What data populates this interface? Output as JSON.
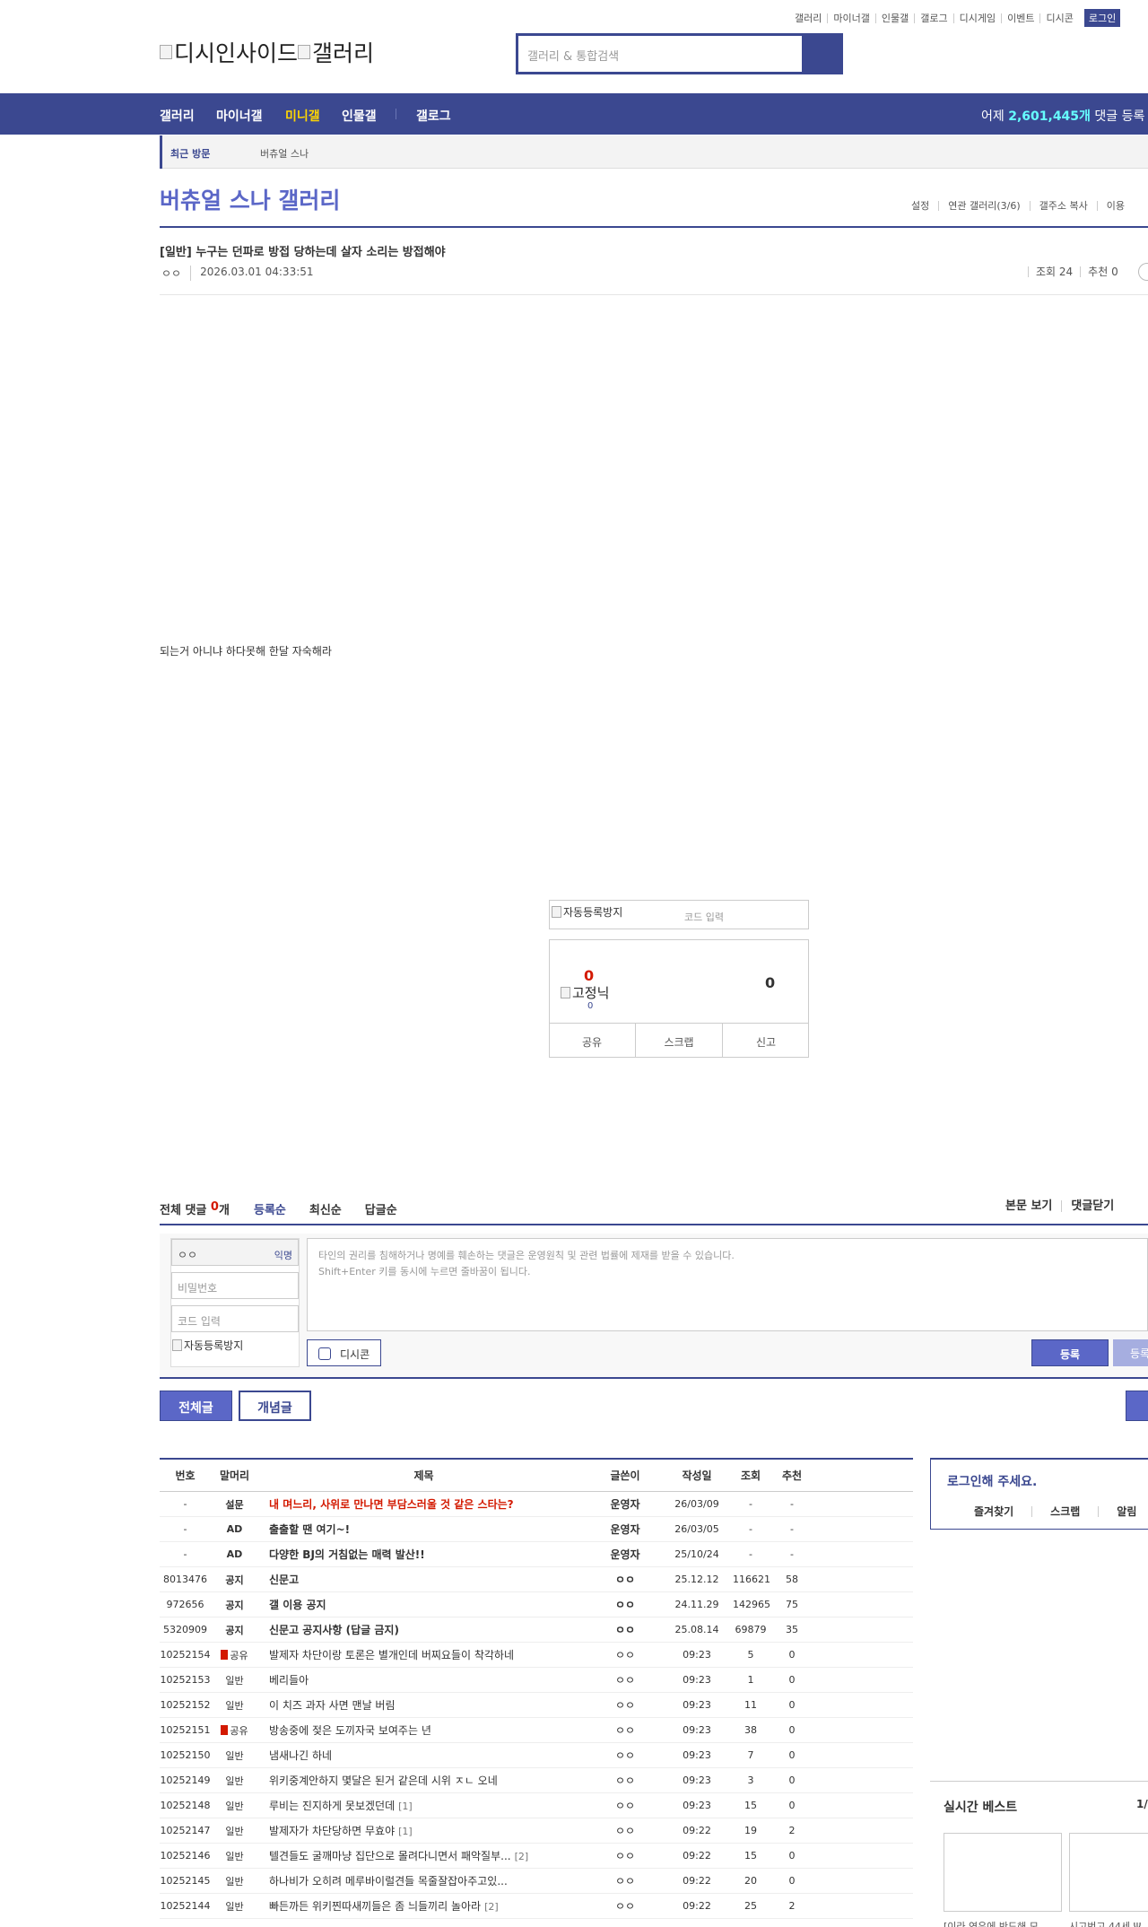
{
  "util_links": [
    "갤러리",
    "마이너갤",
    "인물갤",
    "갤로그",
    "디시게임",
    "이벤트",
    "디시콘"
  ],
  "login_label": "로그인",
  "logo": {
    "main_alt": "디시인사이드",
    "sub_alt": "갤러리"
  },
  "search": {
    "placeholder": "갤러리 & 통합검색"
  },
  "gnb": {
    "items": [
      "갤러리",
      "마이너갤",
      "미니갤",
      "인물갤",
      "갤로그"
    ],
    "active_color": "#ffd600",
    "stat_prefix": "어제",
    "stat_count": "2,601,445개",
    "stat_suffix": "댓글 등록"
  },
  "subnav": {
    "active": "최근 방문",
    "visited": "버츄얼 스나"
  },
  "gallery": {
    "title": "버츄얼 스나 갤러리",
    "menu": [
      "설정",
      "연관 갤러리(3/6)",
      "갤주소 복사",
      "이용"
    ]
  },
  "post": {
    "title": "[일반] 누구는 던파로 방접 당하는데 살자 소리는 방접해야",
    "writer": "ㅇㅇ",
    "date": "2026.03.01 04:33:51",
    "views": "조회 24",
    "recommend": "추천 0",
    "body": "되는거 아니냐 하다못해 한달 자숙해라"
  },
  "captcha": {
    "img_alt": "자동등록방지",
    "placeholder": "코드 입력"
  },
  "reco": {
    "up": "0",
    "fix_alt": "고정닉",
    "fix_count": "0",
    "down": "0",
    "buttons": [
      "공유",
      "스크랩",
      "신고"
    ]
  },
  "comments": {
    "label": "전체 댓글",
    "count": "0",
    "unit": "개",
    "sort": [
      "등록순",
      "최신순",
      "답글순"
    ],
    "right": [
      "본문 보기",
      "댓글닫기"
    ],
    "nick_value": "ㅇㅇ",
    "anon_label": "익명",
    "password_placeholder": "비밀번호",
    "code_placeholder": "코드 입력",
    "captcha_alt": "자동등록방지",
    "notice_line1": "타인의 권리를 침해하거나 명예를 훼손하는 댓글은 운영원칙 및 관련 법률에 제재를 받을 수 있습니다.",
    "notice_line2": "Shift+Enter 키를 동시에 누르면 줄바꿈이 됩니다.",
    "dccon_label": "디시콘",
    "submit_label": "등록",
    "submit2_label": "등록"
  },
  "list_tabs": [
    "전체글",
    "개념글"
  ],
  "list": {
    "headers": [
      "번호",
      "말머리",
      "제목",
      "글쓴이",
      "작성일",
      "조회",
      "추천"
    ],
    "rows": [
      {
        "num": "-",
        "head": "설문",
        "title": "내 며느리, 사위로 만나면 부담스러울 것 같은 스타는?",
        "writer": "운영자",
        "date": "26/03/09",
        "views": "-",
        "reco": "-",
        "type": "survey"
      },
      {
        "num": "-",
        "head": "AD",
        "title": "출출할 땐 여기~!",
        "writer": "운영자",
        "date": "26/03/05",
        "views": "-",
        "reco": "-",
        "type": "notice"
      },
      {
        "num": "-",
        "head": "AD",
        "title": "다양한 BJ의 거침없는 매력 발산!!",
        "writer": "운영자",
        "date": "25/10/24",
        "views": "-",
        "reco": "-",
        "type": "notice"
      },
      {
        "num": "8013476",
        "head": "공지",
        "title": "신문고",
        "writer": "ㅇㅇ",
        "date": "25.12.12",
        "views": "116621",
        "reco": "58",
        "type": "notice"
      },
      {
        "num": "972656",
        "head": "공지",
        "title": "갤 이용 공지",
        "writer": "ㅇㅇ",
        "date": "24.11.29",
        "views": "142965",
        "reco": "75",
        "type": "notice"
      },
      {
        "num": "5320909",
        "head": "공지",
        "title": "신문고 공지사항 (답글 금지)",
        "writer": "ㅇㅇ",
        "date": "25.08.14",
        "views": "69879",
        "reco": "35",
        "type": "notice"
      },
      {
        "num": "10252154",
        "head": "공유",
        "title": "발제자 차단이랑 토론은 별개인데 버찌요들이 착각하네",
        "writer": "ㅇㅇ",
        "date": "09:23",
        "views": "5",
        "reco": "0",
        "type": "share",
        "rc": ""
      },
      {
        "num": "10252153",
        "head": "일반",
        "title": "베리들아",
        "writer": "ㅇㅇ",
        "date": "09:23",
        "views": "1",
        "reco": "0",
        "type": "normal",
        "rc": ""
      },
      {
        "num": "10252152",
        "head": "일반",
        "title": "이 치즈 과자 사면 맨날 버림",
        "writer": "ㅇㅇ",
        "date": "09:23",
        "views": "11",
        "reco": "0",
        "type": "normal",
        "rc": ""
      },
      {
        "num": "10252151",
        "head": "공유",
        "title": "방송중에 젖은 도끼자국 보여주는 년",
        "writer": "ㅇㅇ",
        "date": "09:23",
        "views": "38",
        "reco": "0",
        "type": "share",
        "rc": ""
      },
      {
        "num": "10252150",
        "head": "일반",
        "title": "냄새나긴 하네",
        "writer": "ㅇㅇ",
        "date": "09:23",
        "views": "7",
        "reco": "0",
        "type": "normal",
        "rc": ""
      },
      {
        "num": "10252149",
        "head": "일반",
        "title": "위키중계안하지 몇달은 된거 같은데 시위 ㅈㄴ 오네",
        "writer": "ㅇㅇ",
        "date": "09:23",
        "views": "3",
        "reco": "0",
        "type": "normal",
        "rc": ""
      },
      {
        "num": "10252148",
        "head": "일반",
        "title": "루비는 진지하게 못보겠던데",
        "writer": "ㅇㅇ",
        "date": "09:23",
        "views": "15",
        "reco": "0",
        "type": "normal",
        "rc": "[1]"
      },
      {
        "num": "10252147",
        "head": "일반",
        "title": "발제자가 차단당하면 무효야",
        "writer": "ㅇㅇ",
        "date": "09:22",
        "views": "19",
        "reco": "2",
        "type": "normal",
        "rc": "[1]"
      },
      {
        "num": "10252146",
        "head": "일반",
        "title": "텔견들도 굴깨마냥 집단으로 몰려다니면서 패악질부...",
        "writer": "ㅇㅇ",
        "date": "09:22",
        "views": "15",
        "reco": "0",
        "type": "normal",
        "rc": "[2]"
      },
      {
        "num": "10252145",
        "head": "일반",
        "title": "하나비가 오히려 메루바이럴견들 목줄잘잡아주고있...",
        "writer": "ㅇㅇ",
        "date": "09:22",
        "views": "20",
        "reco": "0",
        "type": "normal",
        "rc": ""
      },
      {
        "num": "10252144",
        "head": "일반",
        "title": "빠든까든 위키찐따새끼들은 좀 늬들끼리 놀아라",
        "writer": "ㅇㅇ",
        "date": "09:22",
        "views": "25",
        "reco": "2",
        "type": "normal",
        "rc": "[2]"
      }
    ]
  },
  "login_box": {
    "title": "로그인해 주세요.",
    "menu": [
      "즐겨찾기",
      "스크랩",
      "알림"
    ]
  },
  "best": {
    "title": "실시간 베스트",
    "page": "1/",
    "captions": [
      "[이라 연우에 반드해 모...",
      "시고번고 44세 Ψ..."
    ]
  }
}
